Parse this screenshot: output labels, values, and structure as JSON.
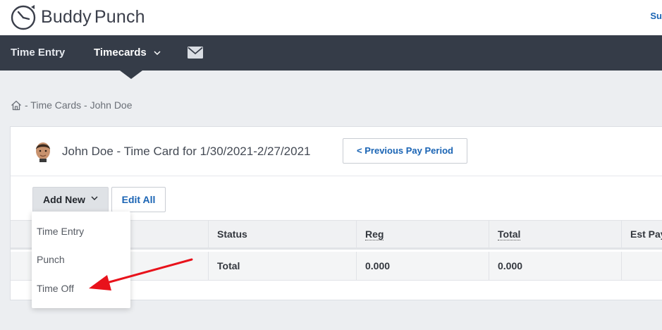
{
  "brand": {
    "name_part1": "Buddy",
    "name_part2": "Punch",
    "accent": "#1a64b4",
    "nav_bg": "#353c48"
  },
  "top_right_link": "Su",
  "nav": {
    "items": [
      {
        "label": "Time Entry"
      },
      {
        "label": "Timecards"
      }
    ],
    "mail_icon": "envelope-icon"
  },
  "breadcrumb": {
    "text": " - Time Cards - John Doe",
    "home_icon": "home-icon"
  },
  "card": {
    "title": "John Doe - Time Card for 1/30/2021-2/27/2021",
    "prev_button": "< Previous Pay Period",
    "add_new": "Add New",
    "edit_all": "Edit All"
  },
  "table": {
    "headers": [
      "Status",
      "Reg",
      "Total",
      "Est Pay"
    ],
    "rows": [
      {
        "status": "Total",
        "reg": "0.000",
        "total": "0.000",
        "est_pay": ""
      }
    ]
  },
  "dropdown": {
    "items": [
      {
        "label": "Time Entry"
      },
      {
        "label": "Punch"
      },
      {
        "label": "Time Off"
      }
    ]
  },
  "annotation": {
    "color": "#e8121b"
  }
}
